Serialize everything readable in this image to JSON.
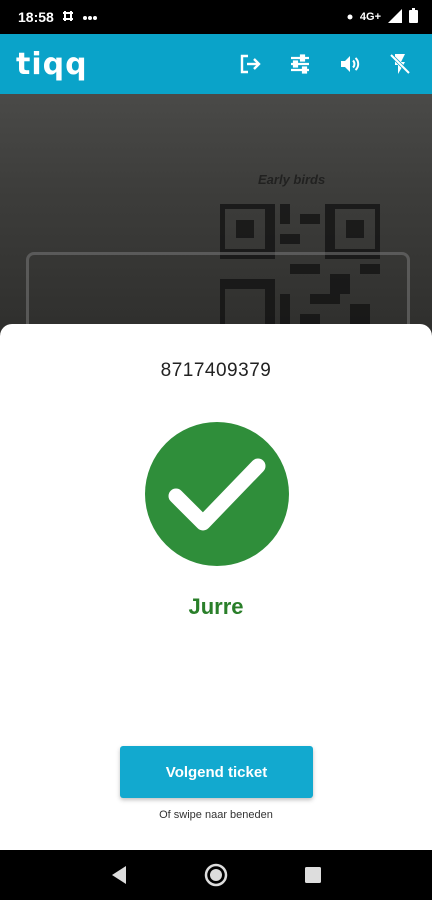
{
  "status_bar": {
    "time": "18:58",
    "left_icons": [
      "slack-icon",
      "more-dots-icon"
    ],
    "network": "4G+",
    "icons": [
      "dot-icon",
      "signal-icon",
      "battery-icon"
    ]
  },
  "app_bar": {
    "logo": "tiqq",
    "background": "#0aa3c9",
    "actions": [
      "logout-icon",
      "tune-icon",
      "volume-icon",
      "flash-off-icon"
    ]
  },
  "camera_preview": {
    "ticket_label": "Early birds"
  },
  "result": {
    "ticket_number": "8717409379",
    "status": "valid",
    "status_color": "#2f8e3a",
    "holder_name": "Jurre",
    "next_button_label": "Volgend ticket",
    "swipe_hint": "Of swipe naar beneden"
  },
  "nav_bar": {
    "buttons": [
      "back-icon",
      "home-icon",
      "recents-icon"
    ]
  }
}
